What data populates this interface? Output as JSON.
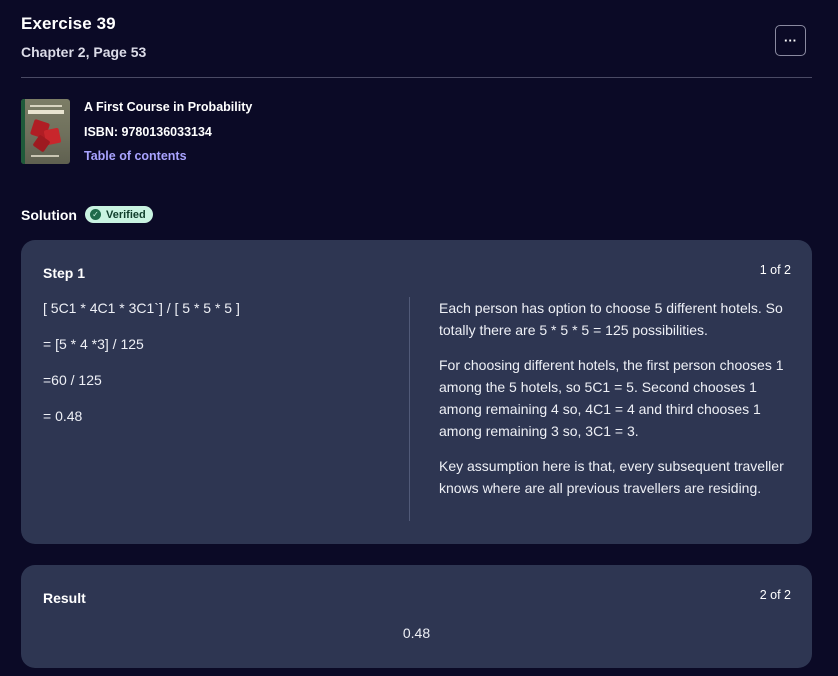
{
  "header": {
    "title": "Exercise 39",
    "subtitle": "Chapter 2, Page 53",
    "more_button_icon": "ellipsis-icon",
    "more_button_label": "···"
  },
  "book": {
    "title": "A First Course in Probability",
    "isbn": "ISBN: 9780136033134",
    "toc_link": "Table of contents"
  },
  "solution": {
    "label": "Solution",
    "badge": "Verified",
    "badge_icon": "check-circle-icon",
    "badge_color": "#c9f3e1"
  },
  "steps": [
    {
      "label": "Step 1",
      "counter": "1 of 2",
      "left_lines": [
        "[ 5C1 * 4C1 * 3C1`] / [ 5 * 5 * 5 ]",
        "= [5 * 4 *3] / 125",
        "=60 / 125",
        "= 0.48"
      ],
      "right_paragraphs": [
        "Each person has option to choose 5 different hotels. So totally there are 5 * 5 * 5 = 125 possibilities.",
        "For choosing different hotels, the first person chooses 1 among the 5 hotels, so 5C1 = 5. Second chooses 1 among remaining 4 so, 4C1 = 4 and third chooses 1 among remaining 3 so, 3C1 = 3.",
        "Key assumption here is that, every subsequent traveller knows where are all previous travellers are residing."
      ]
    }
  ],
  "result": {
    "label": "Result",
    "counter": "2 of 2",
    "value": "0.48"
  },
  "colors": {
    "background": "#0b0a26",
    "card": "#2e3652",
    "link": "#a9a3ff"
  }
}
